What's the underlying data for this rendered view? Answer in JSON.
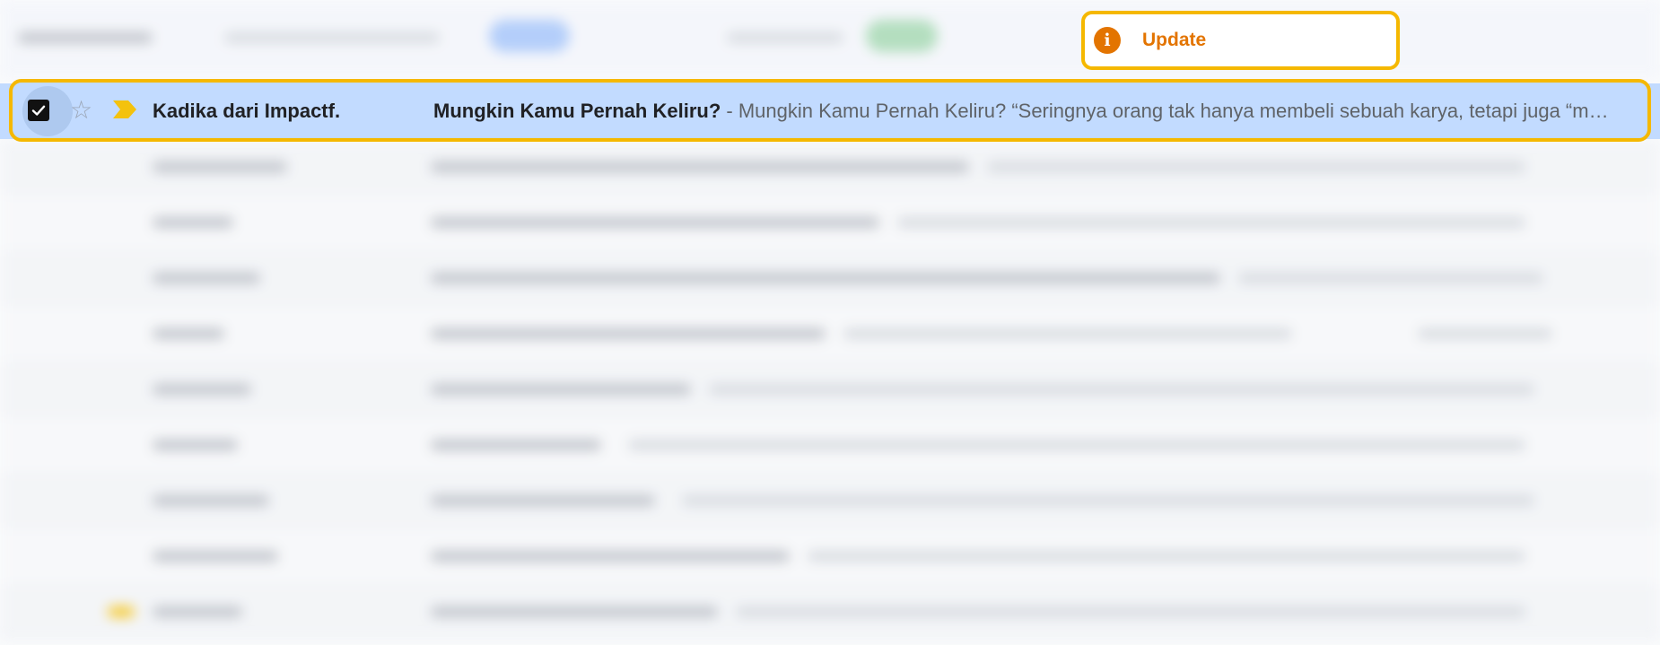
{
  "notification": {
    "label": "Update",
    "icon": "info-icon",
    "color": "#e37400"
  },
  "selected_email": {
    "sender": "Kadika dari Impactf.",
    "subject": "Mungkin Kamu Pernah Keliru?",
    "separator": " - ",
    "snippet": "Mungkin Kamu Pernah Keliru? “Seringnya orang tak hanya membeli sebuah karya, tetapi juga “me…",
    "checked": true,
    "starred": false,
    "important": true
  },
  "colors": {
    "highlight_border": "#f5b800",
    "selected_row": "#c2dbff",
    "importance_marker": "#f4c20d"
  }
}
